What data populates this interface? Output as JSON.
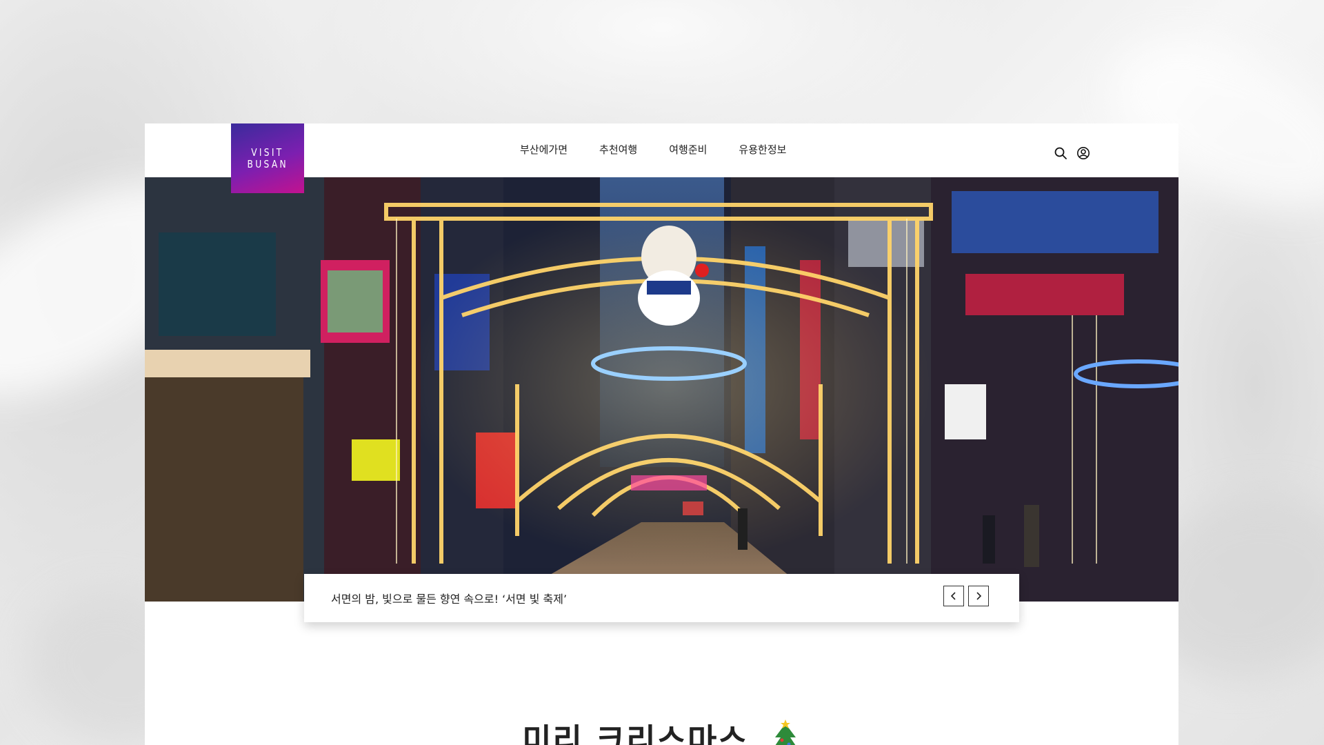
{
  "logo": {
    "line1": "VISIT",
    "line2": "BUSAN"
  },
  "nav": {
    "items": [
      {
        "label": "부산에가면"
      },
      {
        "label": "추천여행"
      },
      {
        "label": "여행준비"
      },
      {
        "label": "유용한정보"
      }
    ]
  },
  "header_icons": [
    "search-icon",
    "user-icon"
  ],
  "hero": {
    "caption": "서면의 밤, 빛으로 물든 향연 속으로! ‘서면 빛 축제’"
  },
  "section": {
    "title": "미리 크리스마스",
    "emoji": "christmas-tree-icon"
  },
  "colors": {
    "logo_gradient_start": "#3a2b9c",
    "logo_gradient_end": "#c3128f",
    "text": "#222222"
  }
}
